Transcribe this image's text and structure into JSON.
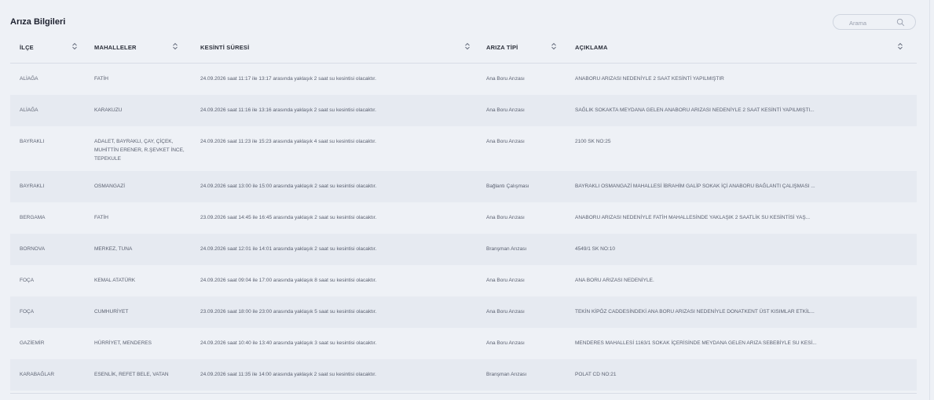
{
  "panel": {
    "title": "Arıza Bilgileri",
    "search_placeholder": "Arama"
  },
  "table": {
    "headers": [
      "İLÇE",
      "MAHALLELER",
      "KESİNTİ SÜRESİ",
      "ARIZA TİPİ",
      "AÇIKLAMA"
    ],
    "rows": [
      [
        "ALİAĞA",
        "FATİH",
        "24.09.2026 saat 11:17 ile 13:17 arasında yaklaşık 2 saat su kesintisi olacaktır.",
        "Ana Boru Arızası",
        "ANABORU ARIZASI NEDENİYLE 2 SAAT KESİNTİ YAPILMIŞTIR"
      ],
      [
        "ALİAĞA",
        "KARAKUZU",
        "24.09.2026 saat 11:16 ile 13:16 arasında yaklaşık 2 saat su kesintisi olacaktır.",
        "Ana Boru Arızası",
        "SAĞLIK SOKAKTA MEYDANA GELEN ANABORU ARIZASI NEDENİYLE 2 SAAT KESİNTİ YAPILMIŞTI..."
      ],
      [
        "BAYRAKLI",
        "ADALET, BAYRAKLI, ÇAY, ÇİÇEK, MUHİTTİN ERENER, R.ŞEVKET İNCE, TEPEKULE",
        "24.09.2026 saat 11:23 ile 15:23 arasında yaklaşık 4 saat su kesintisi olacaktır.",
        "Ana Boru Arızası",
        "2100 SK NO:25"
      ],
      [
        "BAYRAKLI",
        "OSMANGAZİ",
        "24.09.2026 saat 13:00 ile 15:00 arasında yaklaşık 2 saat su kesintisi olacaktır.",
        "Bağlantı Çalışması",
        "BAYRAKLI OSMANGAZİ MAHALLESİ İBRAHİM GALİP SOKAK İÇİ ANABORU BAĞLANTI ÇALIŞMASI ..."
      ],
      [
        "BERGAMA",
        "FATİH",
        "23.09.2026 saat 14:45 ile 16:45 arasında yaklaşık 2 saat su kesintisi olacaktır.",
        "Ana Boru Arızası",
        "ANABORU ARIZASI NEDENİYLE FATİH MAHALLESİNDE YAKLAŞIK 2 SAATLİK SU KESİNTİSİ YAŞ..."
      ],
      [
        "BORNOVA",
        "MERKEZ, TUNA",
        "24.09.2026 saat 12:01 ile 14:01 arasında yaklaşık 2 saat su kesintisi olacaktır.",
        "Branşman Arızası",
        "4549/1 SK NO:10"
      ],
      [
        "FOÇA",
        "KEMAL ATATÜRK",
        "24.09.2026 saat 09:04 ile 17:00 arasında yaklaşık 8 saat su kesintisi olacaktır.",
        "Ana Boru Arızası",
        "ANA BORU ARIZASI NEDENİYLE."
      ],
      [
        "FOÇA",
        "CUMHURİYET",
        "23.09.2026 saat 18:00 ile 23:00 arasında yaklaşık 5 saat su kesintisi olacaktır.",
        "Ana Boru Arızası",
        "TEKİN KİPÖZ CADDESİNDEKİ ANA BORU ARIZASI NEDENİYLE DONATKENT ÜST KISIMLAR ETKİL..."
      ],
      [
        "GAZİEMİR",
        "HÜRRİYET, MENDERES",
        "24.09.2026 saat 10:40 ile 13:40 arasında yaklaşık 3 saat su kesintisi olacaktır.",
        "Ana Boru Arızası",
        "MENDERES MAHALLESİ 1163/1 SOKAK İÇERİSİNDE MEYDANA GELEN ARIZA SEBEBİYLE SU KESİ..."
      ],
      [
        "KARABAĞLAR",
        "ESENLİK, REFET BELE, VATAN",
        "24.09.2026 saat 11:35 ile 14:00 arasında yaklaşık 2 saat su kesintisi olacaktır.",
        "Branşman Arızası",
        "POLAT CD NO:21"
      ]
    ]
  },
  "icons": {
    "search": "search-icon",
    "sort": "sort-arrows-icon"
  }
}
